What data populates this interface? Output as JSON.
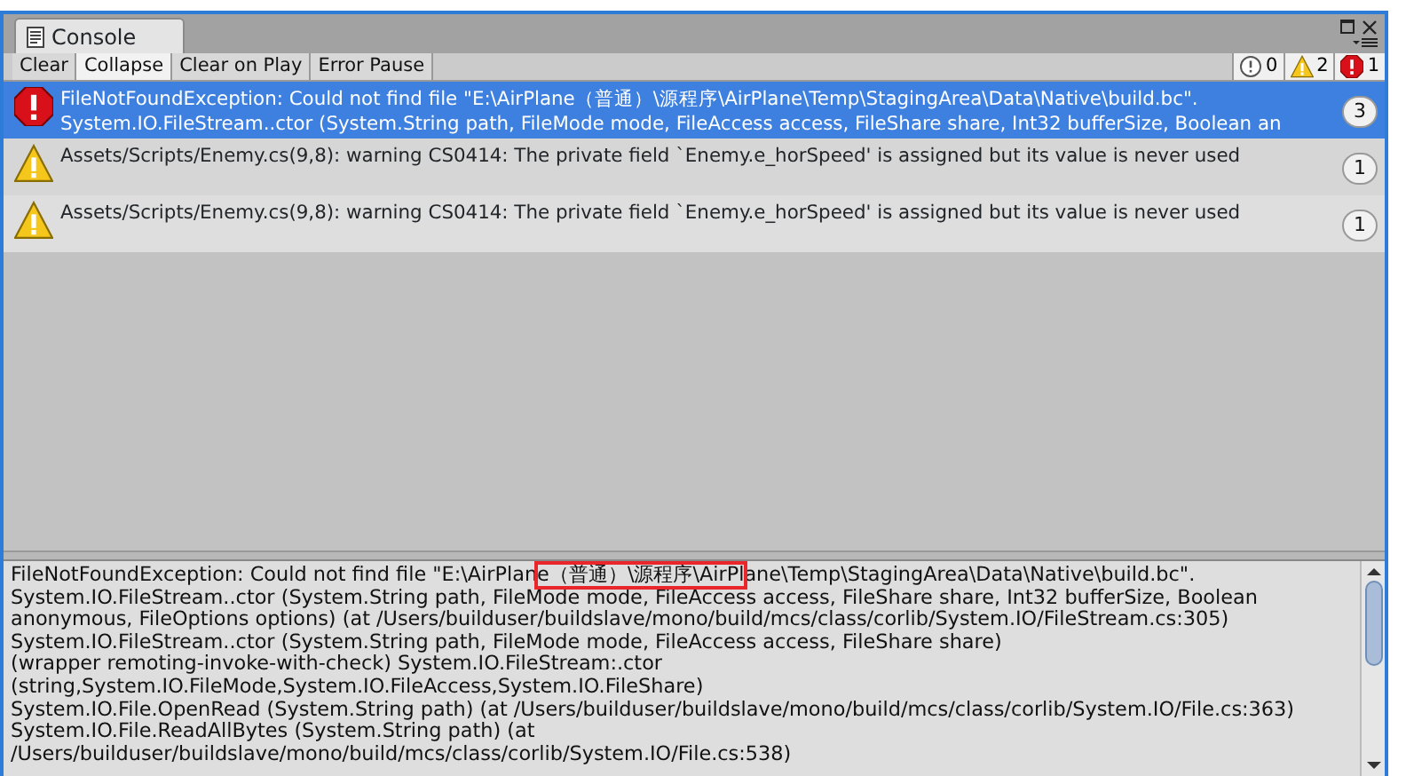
{
  "window": {
    "title": "Console"
  },
  "toolbar": {
    "buttons": [
      {
        "label": "Clear",
        "selected": false
      },
      {
        "label": "Collapse",
        "selected": true
      },
      {
        "label": "Clear on Play",
        "selected": false
      },
      {
        "label": "Error Pause",
        "selected": false
      }
    ],
    "counters": [
      {
        "kind": "info",
        "count": "0"
      },
      {
        "kind": "warning",
        "count": "2"
      },
      {
        "kind": "error",
        "count": "1"
      }
    ]
  },
  "log": [
    {
      "kind": "error",
      "selected": true,
      "lines": [
        "FileNotFoundException: Could not find file \"E:\\AirPlane（普通）\\源程序\\AirPlane\\Temp\\StagingArea\\Data\\Native\\build.bc\".",
        "System.IO.FileStream..ctor (System.String path, FileMode mode, FileAccess access, FileShare share, Int32 bufferSize, Boolean an"
      ],
      "count": "3"
    },
    {
      "kind": "warning",
      "selected": false,
      "lines": [
        "Assets/Scripts/Enemy.cs(9,8): warning CS0414: The private field `Enemy.e_horSpeed' is assigned but its value is never used"
      ],
      "count": "1"
    },
    {
      "kind": "warning",
      "selected": false,
      "lines": [
        "Assets/Scripts/Enemy.cs(9,8): warning CS0414: The private field `Enemy.e_horSpeed' is assigned but its value is never used"
      ],
      "count": "1"
    }
  ],
  "detail": {
    "lines": [
      "FileNotFoundException: Could not find file \"E:\\AirPlane（普通）\\源程序\\AirPlane\\Temp\\StagingArea\\Data\\Native\\build.bc\".",
      "System.IO.FileStream..ctor (System.String path, FileMode mode, FileAccess access, FileShare share, Int32 bufferSize, Boolean",
      "anonymous, FileOptions options) (at /Users/builduser/buildslave/mono/build/mcs/class/corlib/System.IO/FileStream.cs:305)",
      "System.IO.FileStream..ctor (System.String path, FileMode mode, FileAccess access, FileShare share)",
      "(wrapper remoting-invoke-with-check) System.IO.FileStream:.ctor",
      "(string,System.IO.FileMode,System.IO.FileAccess,System.IO.FileShare)",
      "System.IO.File.OpenRead (System.String path) (at /Users/builduser/buildslave/mono/build/mcs/class/corlib/System.IO/File.cs:363)",
      "System.IO.File.ReadAllBytes (System.String path) (at",
      "/Users/builduser/buildslave/mono/build/mcs/class/corlib/System.IO/File.cs:538)"
    ]
  }
}
